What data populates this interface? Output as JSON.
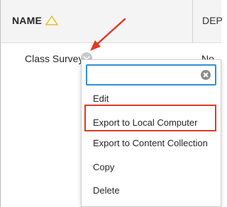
{
  "table": {
    "header": {
      "name_label": "NAME",
      "next_col_label": "DEP"
    },
    "row": {
      "title": "Class Survey",
      "next_col_value": "No"
    }
  },
  "menu": {
    "search": {
      "value": "",
      "placeholder": ""
    },
    "items": [
      {
        "label": "Edit"
      },
      {
        "label": "Export to Local Computer"
      },
      {
        "label": "Export to Content Collection"
      },
      {
        "label": "Copy"
      },
      {
        "label": "Delete"
      }
    ]
  },
  "colors": {
    "accent_focus": "#2f8fd8",
    "annotation_red": "#e03a24",
    "sort_icon": "#e8b93a"
  },
  "icons": {
    "sort": "sort-ascending-triangle-icon",
    "chevron": "chevron-down-icon",
    "clear": "clear-search-icon",
    "annotation": "annotation-arrow-icon"
  }
}
